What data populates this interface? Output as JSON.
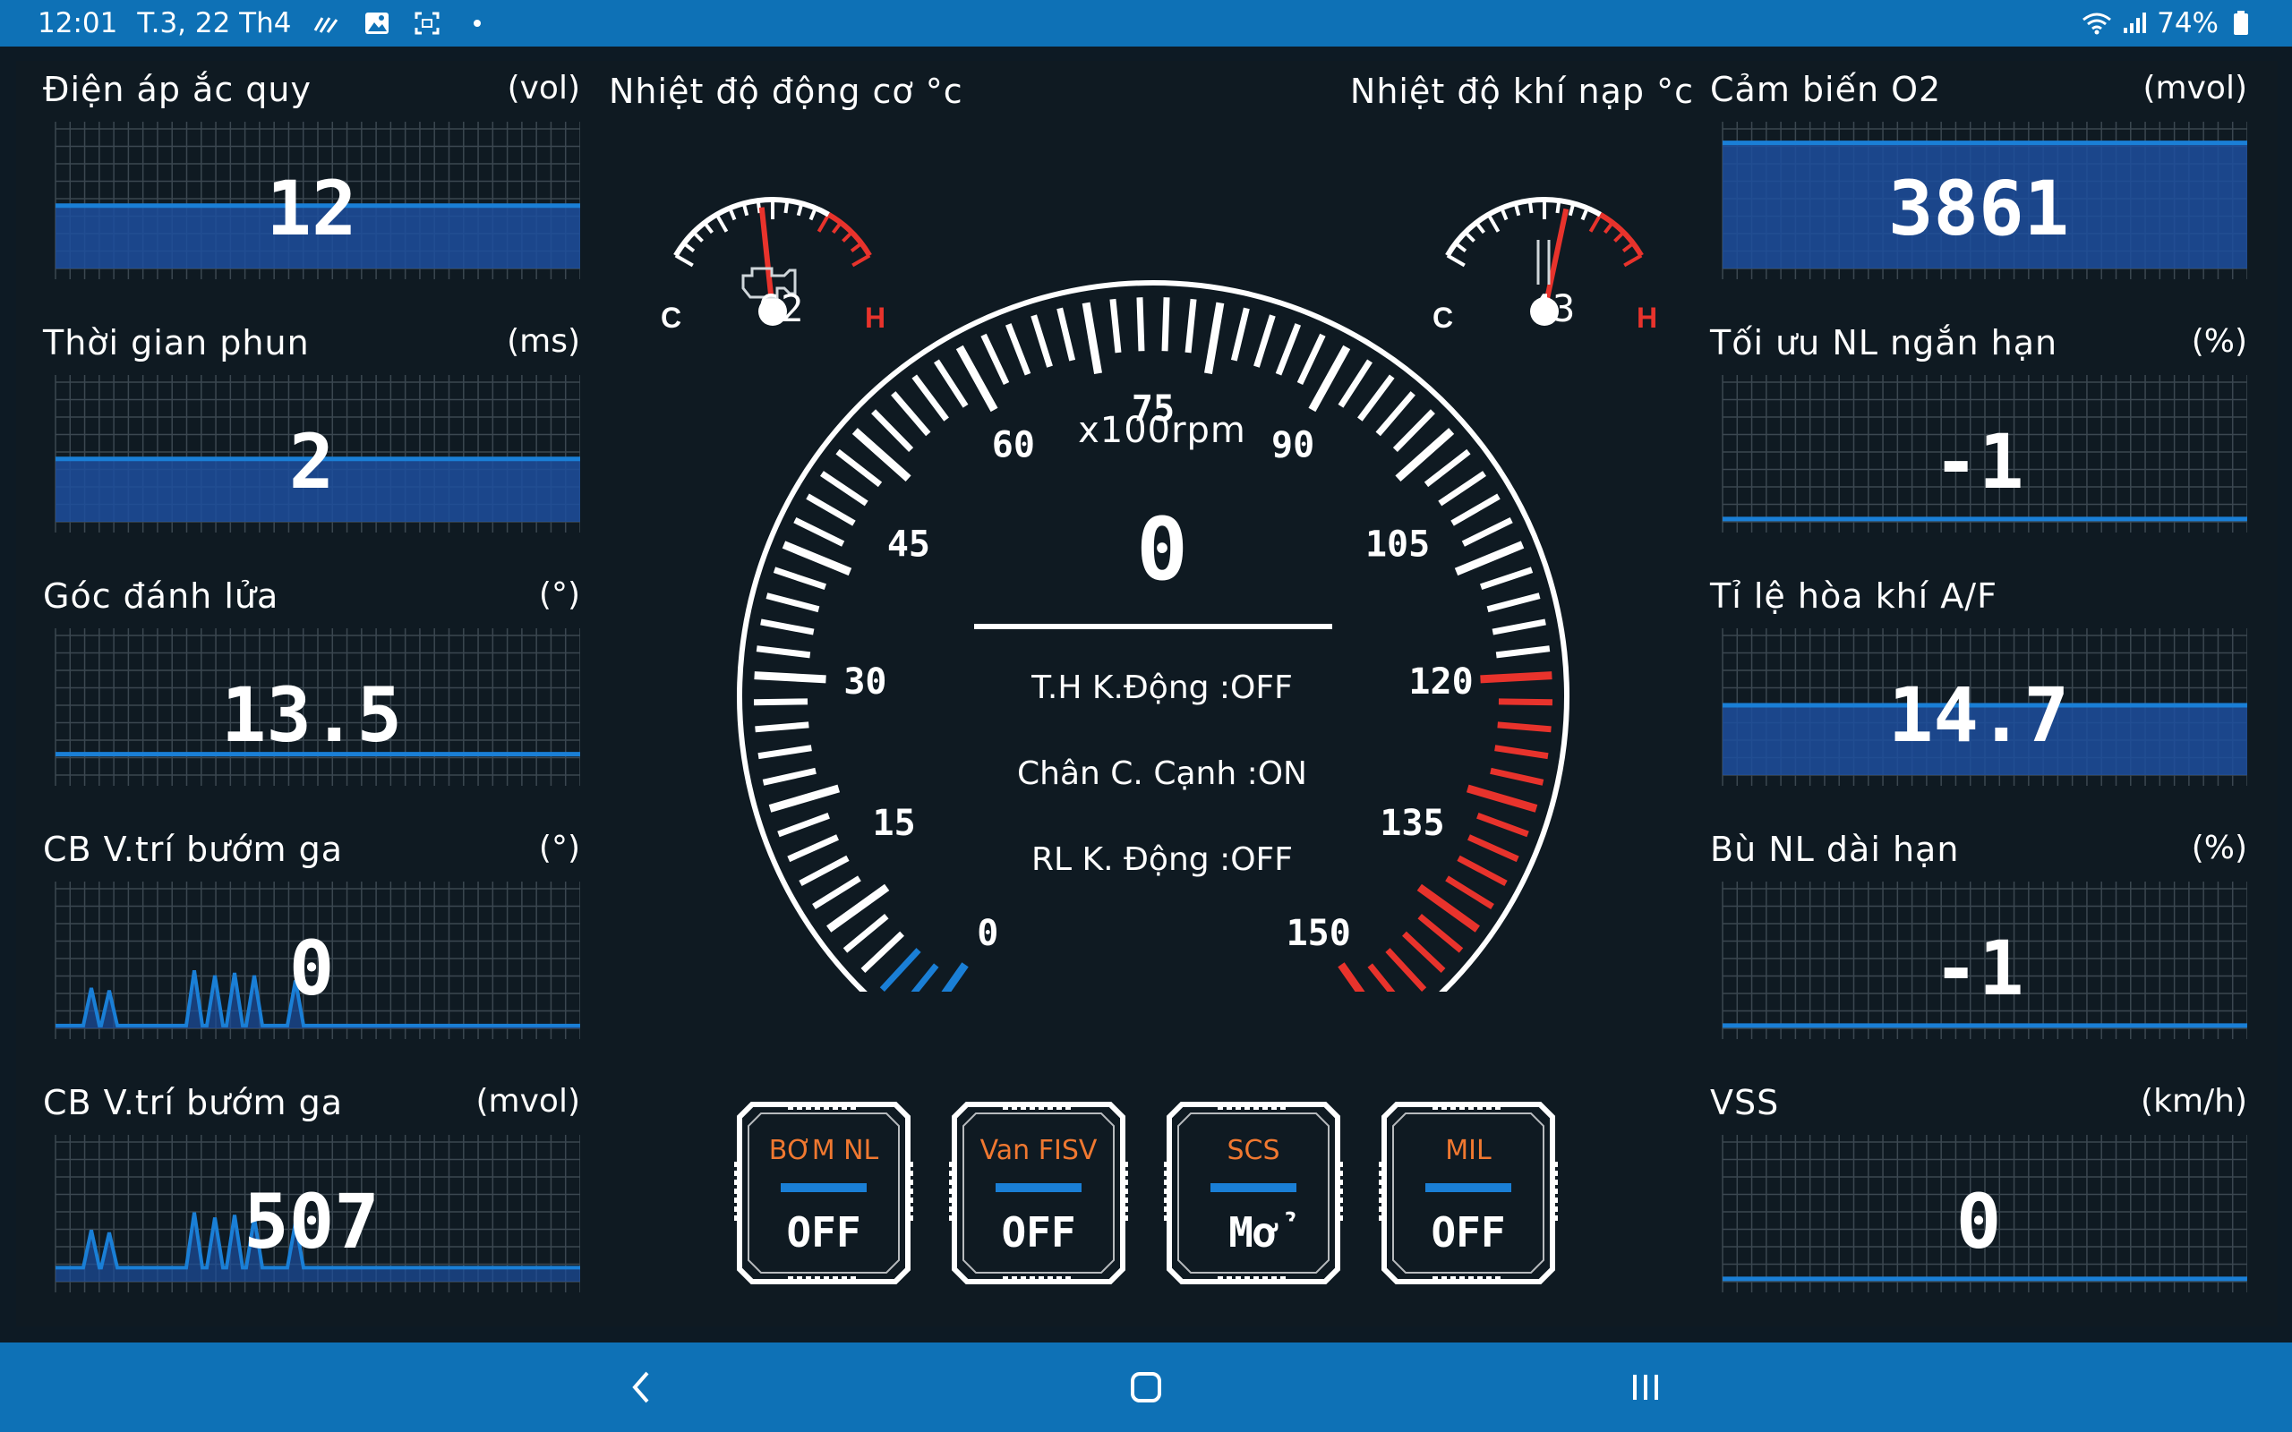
{
  "status_bar": {
    "time": "12:01",
    "date": "T.3, 22 Th4",
    "battery": "74%",
    "icons": [
      "signal-wave-icon",
      "gallery-icon",
      "screenshot-icon",
      "dot-icon",
      "wifi-icon",
      "cell-signal-icon",
      "battery-icon"
    ]
  },
  "left_panels": [
    {
      "title": "Điện áp ắc quy",
      "unit": "(vol)",
      "value": "12",
      "style": "filled",
      "level": 0.45
    },
    {
      "title": "Thời gian phun",
      "unit": "(ms)",
      "value": "2",
      "style": "filled",
      "level": 0.45
    },
    {
      "title": "Góc đánh lửa",
      "unit": "(°)",
      "value": "13.5",
      "style": "line",
      "level": 0.15
    },
    {
      "title": "CB V.trí bướm ga",
      "unit": "(°)",
      "value": "0",
      "style": "spikes",
      "level": 0.02
    },
    {
      "title": "CB V.trí bướm ga",
      "unit": "(mvol)",
      "value": "507",
      "style": "spikes",
      "level": 0.1
    }
  ],
  "right_panels": [
    {
      "title": "Cảm biến O2",
      "unit": "(mvol)",
      "value": "3861",
      "style": "filled",
      "level": 0.9
    },
    {
      "title": "Tối ưu NL ngắn hạn",
      "unit": "(%)",
      "value": "-1",
      "style": "line",
      "level": 0.02
    },
    {
      "title": "Tỉ lệ hòa khí A/F",
      "unit": "",
      "value": "14.7",
      "style": "filled",
      "level": 0.5
    },
    {
      "title": "Bù NL dài hạn",
      "unit": "(%)",
      "value": "-1",
      "style": "line",
      "level": 0.02
    },
    {
      "title": "VSS",
      "unit": "(km/h)",
      "value": "0",
      "style": "line",
      "level": 0.02
    }
  ],
  "engine_temp": {
    "title": "Nhiệt độ động cơ °c",
    "value": "62",
    "cold_label": "C",
    "hot_label": "H",
    "level": 0.45,
    "icon": "engine-icon"
  },
  "intake_temp": {
    "title": "Nhiệt độ khí nạp °c",
    "value": "43",
    "cold_label": "C",
    "hot_label": "H",
    "level": 0.6,
    "icon": "thermometer-icon"
  },
  "tachometer": {
    "unit": "x100rpm",
    "value": "0",
    "ticks": [
      "0",
      "15",
      "30",
      "45",
      "60",
      "75",
      "90",
      "105",
      "120",
      "135",
      "150"
    ],
    "redline_from": 120
  },
  "status_lines": [
    "T.H K.Động :OFF",
    "Chân C. Cạnh :ON",
    "RL K. Động :OFF"
  ],
  "indicators": [
    {
      "label": "BƠM NL",
      "state": "OFF"
    },
    {
      "label": "Van FISV",
      "state": "OFF"
    },
    {
      "label": "SCS",
      "state": "Mở"
    },
    {
      "label": "MIL",
      "state": "OFF"
    }
  ],
  "colors": {
    "accent": "#1a7fd6",
    "fill": "#1d4f9e",
    "red": "#e8332c",
    "bar": "#0e71b6",
    "orange": "#f07830"
  }
}
